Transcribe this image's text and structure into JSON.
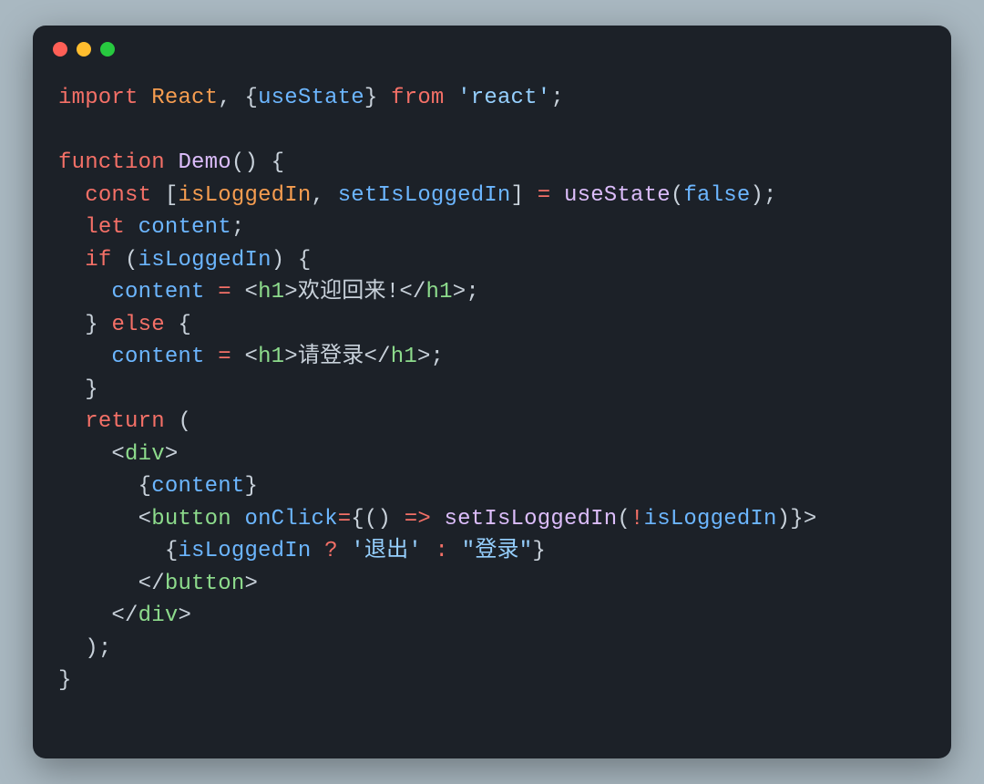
{
  "window": {
    "title": "",
    "traffic_lights": [
      "close",
      "minimize",
      "zoom"
    ]
  },
  "code": {
    "lines": [
      {
        "indent": 0,
        "tokens": [
          {
            "t": "k",
            "v": "import"
          },
          {
            "t": "p",
            "v": " "
          },
          {
            "t": "o",
            "v": "React"
          },
          {
            "t": "p",
            "v": ", {"
          },
          {
            "t": "b",
            "v": "useState"
          },
          {
            "t": "p",
            "v": "} "
          },
          {
            "t": "k",
            "v": "from"
          },
          {
            "t": "p",
            "v": " "
          },
          {
            "t": "s",
            "v": "'react'"
          },
          {
            "t": "p",
            "v": ";"
          }
        ]
      },
      {
        "indent": 0,
        "tokens": []
      },
      {
        "indent": 0,
        "tokens": [
          {
            "t": "k",
            "v": "function"
          },
          {
            "t": "p",
            "v": " "
          },
          {
            "t": "fn",
            "v": "Demo"
          },
          {
            "t": "p",
            "v": "() {"
          }
        ]
      },
      {
        "indent": 1,
        "tokens": [
          {
            "t": "k",
            "v": "const"
          },
          {
            "t": "p",
            "v": " ["
          },
          {
            "t": "o",
            "v": "isLoggedIn"
          },
          {
            "t": "p",
            "v": ", "
          },
          {
            "t": "b",
            "v": "setIsLoggedIn"
          },
          {
            "t": "p",
            "v": "] "
          },
          {
            "t": "k",
            "v": "="
          },
          {
            "t": "p",
            "v": " "
          },
          {
            "t": "fn",
            "v": "useState"
          },
          {
            "t": "p",
            "v": "("
          },
          {
            "t": "bool",
            "v": "false"
          },
          {
            "t": "p",
            "v": ");"
          }
        ]
      },
      {
        "indent": 1,
        "tokens": [
          {
            "t": "k",
            "v": "let"
          },
          {
            "t": "p",
            "v": " "
          },
          {
            "t": "b",
            "v": "content"
          },
          {
            "t": "p",
            "v": ";"
          }
        ]
      },
      {
        "indent": 1,
        "tokens": [
          {
            "t": "k",
            "v": "if"
          },
          {
            "t": "p",
            "v": " ("
          },
          {
            "t": "b",
            "v": "isLoggedIn"
          },
          {
            "t": "p",
            "v": ") {"
          }
        ]
      },
      {
        "indent": 2,
        "tokens": [
          {
            "t": "b",
            "v": "content"
          },
          {
            "t": "p",
            "v": " "
          },
          {
            "t": "k",
            "v": "="
          },
          {
            "t": "p",
            "v": " <"
          },
          {
            "t": "t",
            "v": "h1"
          },
          {
            "t": "p",
            "v": ">"
          },
          {
            "t": "p",
            "v": "欢迎回来!"
          },
          {
            "t": "p",
            "v": "</"
          },
          {
            "t": "t",
            "v": "h1"
          },
          {
            "t": "p",
            "v": ">;"
          }
        ]
      },
      {
        "indent": 1,
        "tokens": [
          {
            "t": "p",
            "v": "} "
          },
          {
            "t": "k",
            "v": "else"
          },
          {
            "t": "p",
            "v": " {"
          }
        ]
      },
      {
        "indent": 2,
        "tokens": [
          {
            "t": "b",
            "v": "content"
          },
          {
            "t": "p",
            "v": " "
          },
          {
            "t": "k",
            "v": "="
          },
          {
            "t": "p",
            "v": " <"
          },
          {
            "t": "t",
            "v": "h1"
          },
          {
            "t": "p",
            "v": ">"
          },
          {
            "t": "p",
            "v": "请登录"
          },
          {
            "t": "p",
            "v": "</"
          },
          {
            "t": "t",
            "v": "h1"
          },
          {
            "t": "p",
            "v": ">;"
          }
        ]
      },
      {
        "indent": 1,
        "tokens": [
          {
            "t": "p",
            "v": "}"
          }
        ]
      },
      {
        "indent": 1,
        "tokens": [
          {
            "t": "k",
            "v": "return"
          },
          {
            "t": "p",
            "v": " ("
          }
        ]
      },
      {
        "indent": 2,
        "tokens": [
          {
            "t": "p",
            "v": "<"
          },
          {
            "t": "t",
            "v": "div"
          },
          {
            "t": "p",
            "v": ">"
          }
        ]
      },
      {
        "indent": 3,
        "tokens": [
          {
            "t": "p",
            "v": "{"
          },
          {
            "t": "b",
            "v": "content"
          },
          {
            "t": "p",
            "v": "}"
          }
        ]
      },
      {
        "indent": 3,
        "tokens": [
          {
            "t": "p",
            "v": "<"
          },
          {
            "t": "t",
            "v": "button"
          },
          {
            "t": "p",
            "v": " "
          },
          {
            "t": "attr",
            "v": "onClick"
          },
          {
            "t": "k",
            "v": "="
          },
          {
            "t": "p",
            "v": "{() "
          },
          {
            "t": "k",
            "v": "=>"
          },
          {
            "t": "p",
            "v": " "
          },
          {
            "t": "fn",
            "v": "setIsLoggedIn"
          },
          {
            "t": "p",
            "v": "("
          },
          {
            "t": "k",
            "v": "!"
          },
          {
            "t": "b",
            "v": "isLoggedIn"
          },
          {
            "t": "p",
            "v": ")}>"
          }
        ]
      },
      {
        "indent": 4,
        "tokens": [
          {
            "t": "p",
            "v": "{"
          },
          {
            "t": "b",
            "v": "isLoggedIn"
          },
          {
            "t": "p",
            "v": " "
          },
          {
            "t": "k",
            "v": "?"
          },
          {
            "t": "p",
            "v": " "
          },
          {
            "t": "s",
            "v": "'退出'"
          },
          {
            "t": "p",
            "v": " "
          },
          {
            "t": "k",
            "v": ":"
          },
          {
            "t": "p",
            "v": " "
          },
          {
            "t": "s",
            "v": "\"登录\""
          },
          {
            "t": "p",
            "v": "}"
          }
        ]
      },
      {
        "indent": 3,
        "tokens": [
          {
            "t": "p",
            "v": "</"
          },
          {
            "t": "t",
            "v": "button"
          },
          {
            "t": "p",
            "v": ">"
          }
        ]
      },
      {
        "indent": 2,
        "tokens": [
          {
            "t": "p",
            "v": "</"
          },
          {
            "t": "t",
            "v": "div"
          },
          {
            "t": "p",
            "v": ">"
          }
        ]
      },
      {
        "indent": 1,
        "tokens": [
          {
            "t": "p",
            "v": ");"
          }
        ]
      },
      {
        "indent": 0,
        "tokens": [
          {
            "t": "p",
            "v": "}"
          }
        ]
      }
    ],
    "indent_unit": "  "
  }
}
